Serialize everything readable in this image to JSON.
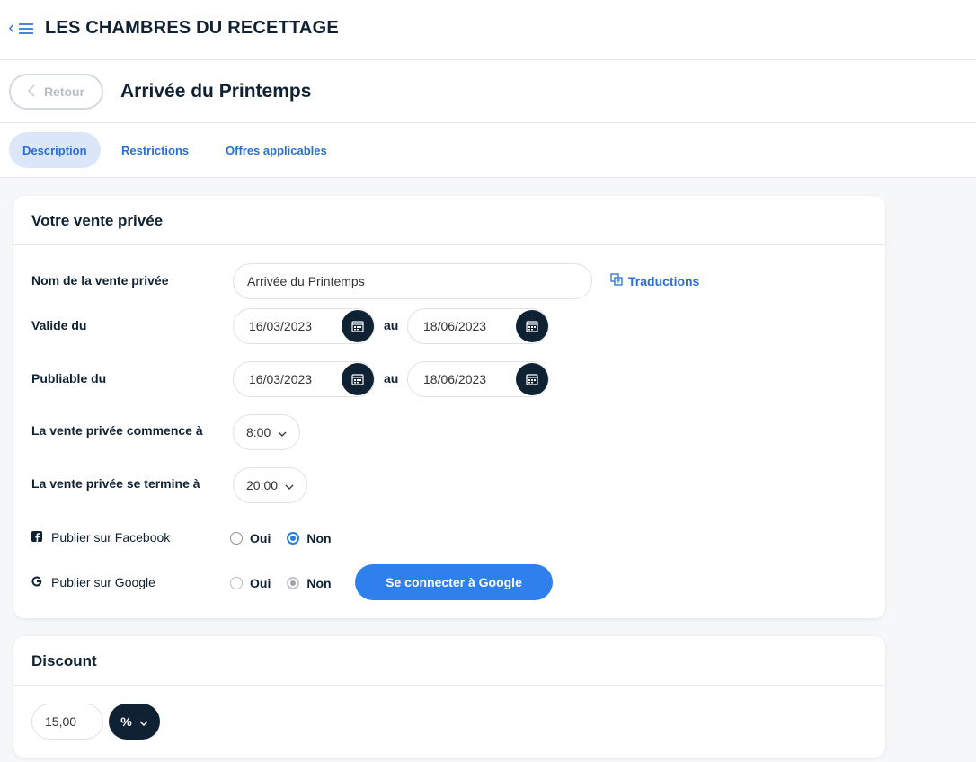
{
  "app": {
    "title": "LES CHAMBRES DU RECETTAGE"
  },
  "page": {
    "back_label": "Retour",
    "title": "Arrivée du Printemps"
  },
  "tabs": [
    {
      "label": "Description",
      "active": true
    },
    {
      "label": "Restrictions",
      "active": false
    },
    {
      "label": "Offres applicables",
      "active": false
    }
  ],
  "sale": {
    "section_title": "Votre vente privée",
    "name_label": "Nom de la vente privée",
    "name_value": "Arrivée du Printemps",
    "translations_label": "Traductions",
    "valid_label": "Valide du",
    "valid_from": "16/03/2023",
    "valid_to": "18/06/2023",
    "publishable_label": "Publiable du",
    "publishable_from": "16/03/2023",
    "publishable_to": "18/06/2023",
    "between_label": "au",
    "start_label": "La vente privée commence à",
    "start_time": "8:00",
    "end_label": "La vente privée se termine à",
    "end_time": "20:00",
    "facebook_label": "Publier sur Facebook",
    "facebook_yes": "Oui",
    "facebook_no": "Non",
    "facebook_selected": "Non",
    "google_label": "Publier sur Google",
    "google_yes": "Oui",
    "google_no": "Non",
    "google_selected": "Non",
    "google_connect_label": "Se connecter à Google"
  },
  "discount": {
    "section_title": "Discount",
    "value": "15,00",
    "unit": "%"
  },
  "colors": {
    "accent": "#2f80ed",
    "dark": "#0f2233",
    "tab_active_bg": "#dbe6f8"
  },
  "icons": [
    "menu-collapse-icon",
    "chevron-left-icon",
    "translate-icon",
    "calendar-icon",
    "chevron-down-icon",
    "facebook-icon",
    "google-icon"
  ]
}
